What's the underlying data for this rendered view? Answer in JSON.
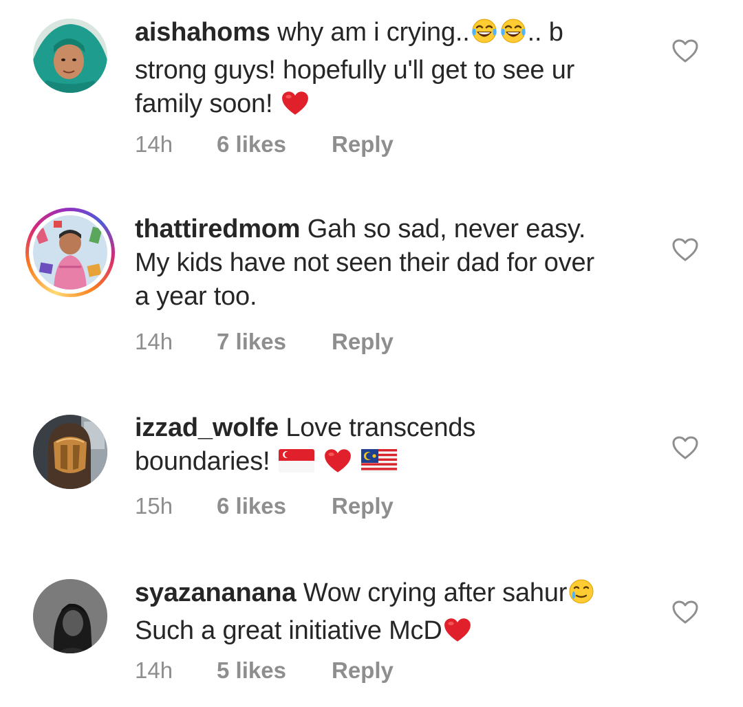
{
  "comments": [
    {
      "username": "aishahoms",
      "text_lines": [
        "why am i crying..",
        ".. b",
        "strong guys! hopefully u'll get to see ur",
        "family soon! "
      ],
      "time": "14h",
      "likes": "6 likes",
      "reply": "Reply",
      "avatar_icon": "avatar-hijab-teal",
      "has_story_ring": false
    },
    {
      "username": "thattiredmom",
      "text_lines": [
        "Gah so sad, never easy.",
        "My kids have not seen their dad for over",
        "a year too."
      ],
      "time": "14h",
      "likes": "7 likes",
      "reply": "Reply",
      "avatar_icon": "avatar-child-story",
      "has_story_ring": true
    },
    {
      "username": "izzad_wolfe",
      "text_lines": [
        "Love transcends",
        "boundaries! "
      ],
      "time": "15h",
      "likes": "6 likes",
      "reply": "Reply",
      "avatar_icon": "avatar-helmet",
      "has_story_ring": false
    },
    {
      "username": "syazananana",
      "text_lines": [
        "Wow crying after sahur",
        "Such a great initiative McD"
      ],
      "time": "14h",
      "likes": "5 likes",
      "reply": "Reply",
      "avatar_icon": "avatar-dark-portrait",
      "has_story_ring": false
    }
  ],
  "icons": {
    "like": "heart-outline-icon",
    "emoji_laugh": "tears-of-joy-icon",
    "emoji_heart": "red-heart-icon",
    "emoji_flag_sg": "singapore-flag-icon",
    "emoji_flag_my": "malaysia-flag-icon",
    "emoji_tear_smile": "smiling-face-with-tear-icon"
  },
  "colors": {
    "text": "#262626",
    "meta": "#8e8e8e",
    "heart_red": "#e0202a"
  }
}
